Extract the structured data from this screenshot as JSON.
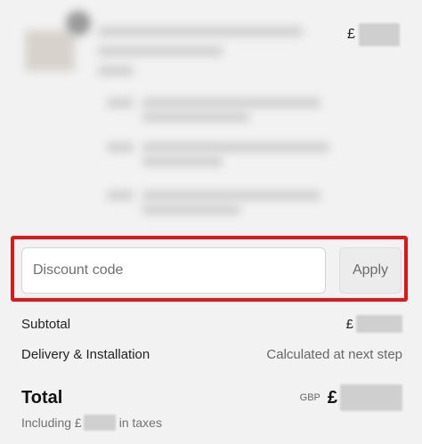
{
  "order_summary": {
    "line_item_price_symbol": "£"
  },
  "discount": {
    "placeholder": "Discount code",
    "apply_label": "Apply"
  },
  "totals": {
    "subtotal_label": "Subtotal",
    "subtotal_symbol": "£",
    "delivery_label": "Delivery & Installation",
    "delivery_value": "Calculated at next step",
    "total_label": "Total",
    "currency_code": "GBP",
    "total_symbol": "£",
    "tax_prefix": "Including £",
    "tax_suffix": "in taxes"
  },
  "colors": {
    "highlight_border": "#e01717",
    "background": "#f2f2f2"
  }
}
